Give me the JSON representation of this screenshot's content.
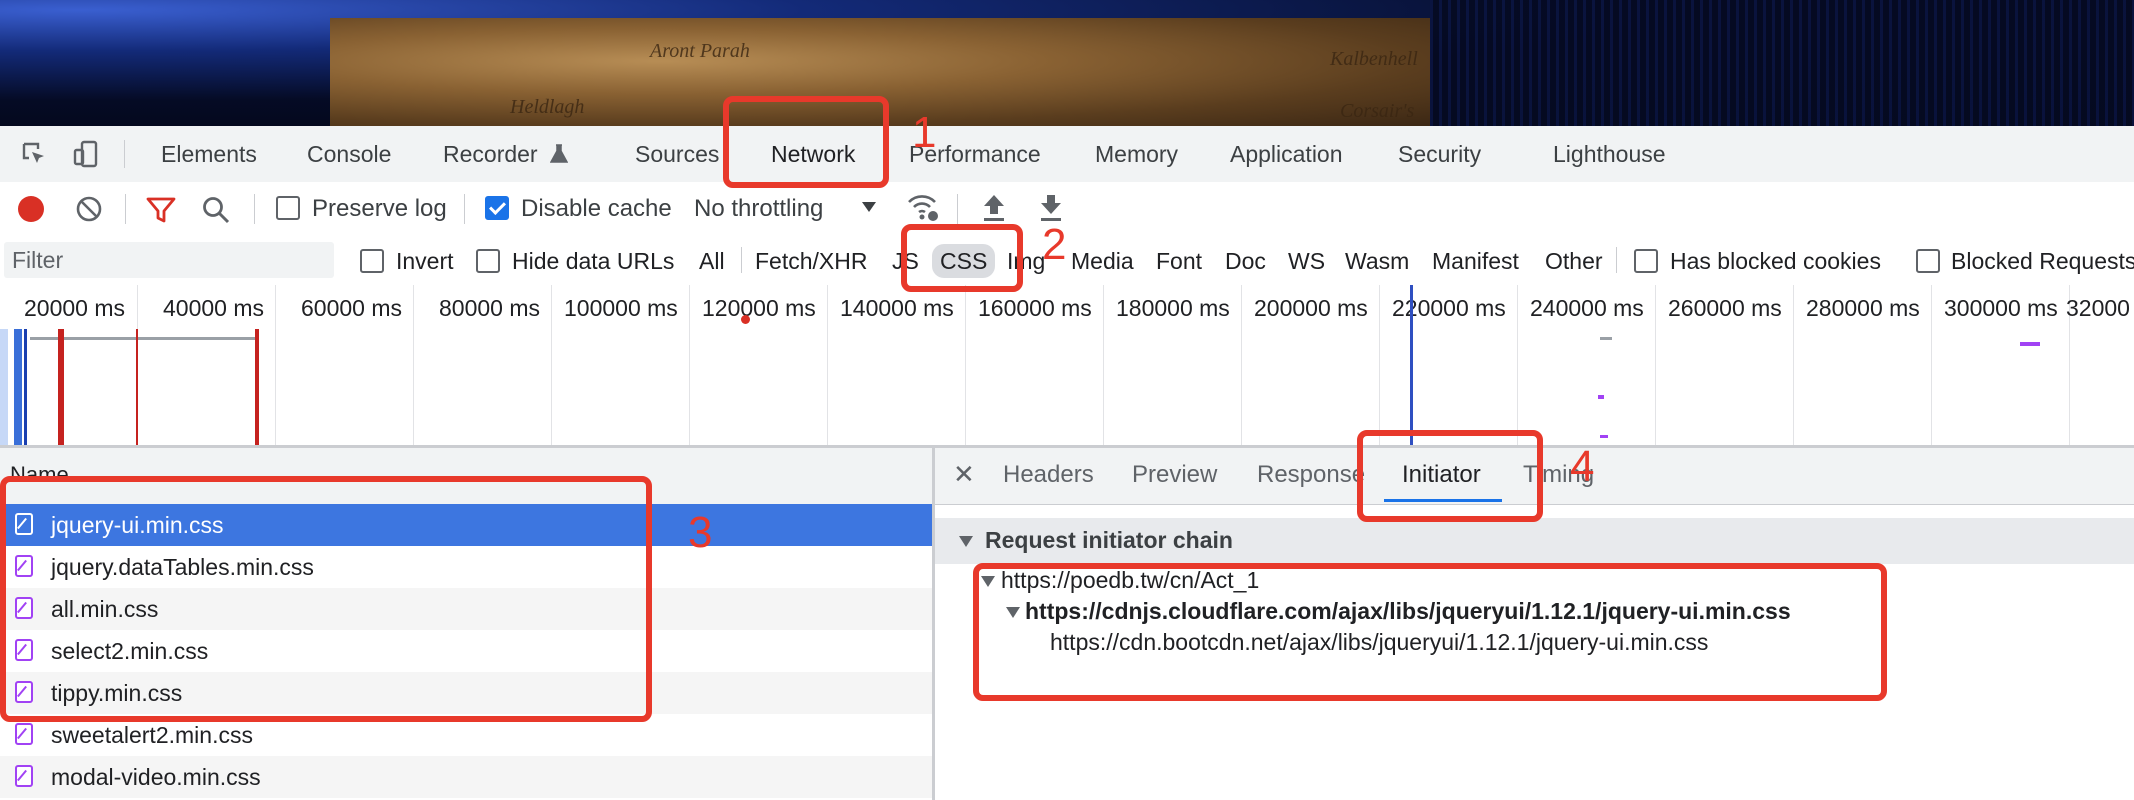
{
  "banner": {
    "map_labels": [
      "Aront Parah",
      "Kalbenhell",
      "Heldlagh",
      "Corsair's"
    ]
  },
  "devtools_tabs": [
    "Elements",
    "Console",
    "Recorder",
    "Sources",
    "Network",
    "Performance",
    "Memory",
    "Application",
    "Security",
    "Lighthouse"
  ],
  "toolbar": {
    "preserve_log": "Preserve log",
    "preserve_log_checked": false,
    "disable_cache": "Disable cache",
    "disable_cache_checked": true,
    "throttling": "No throttling"
  },
  "filterbar": {
    "placeholder": "Filter",
    "invert": "Invert",
    "hide_data_urls": "Hide data URLs",
    "types": [
      "All",
      "Fetch/XHR",
      "JS",
      "CSS",
      "Img",
      "Media",
      "Font",
      "Doc",
      "WS",
      "Wasm",
      "Manifest",
      "Other"
    ],
    "selected_type": "CSS",
    "has_blocked_cookies": "Has blocked cookies",
    "blocked_requests": "Blocked Requests"
  },
  "overview": {
    "ticks": [
      "20000 ms",
      "40000 ms",
      "60000 ms",
      "80000 ms",
      "100000 ms",
      "120000 ms",
      "140000 ms",
      "160000 ms",
      "180000 ms",
      "200000 ms",
      "220000 ms",
      "240000 ms",
      "260000 ms",
      "280000 ms",
      "300000 ms",
      "32000"
    ]
  },
  "requests": {
    "header": "Name",
    "rows": [
      "jquery-ui.min.css",
      "jquery.dataTables.min.css",
      "all.min.css",
      "select2.min.css",
      "tippy.min.css",
      "sweetalert2.min.css",
      "modal-video.min.css"
    ],
    "selected_index": 0
  },
  "details": {
    "tabs": [
      "Headers",
      "Preview",
      "Response",
      "Initiator",
      "Timing"
    ],
    "active_tab": "Initiator",
    "chain_title": "Request initiator chain",
    "chain": [
      "https://poedb.tw/cn/Act_1",
      "https://cdnjs.cloudflare.com/ajax/libs/jqueryui/1.12.1/jquery-ui.min.css",
      "https://cdn.bootcdn.net/ajax/libs/jqueryui/1.12.1/jquery-ui.min.css"
    ]
  },
  "annotations": [
    "1",
    "2",
    "3",
    "4"
  ],
  "colors": {
    "accent": "#1a73e8",
    "selected_row": "#3d76e0",
    "annotation": "#e8392b",
    "record": "#d93025"
  }
}
